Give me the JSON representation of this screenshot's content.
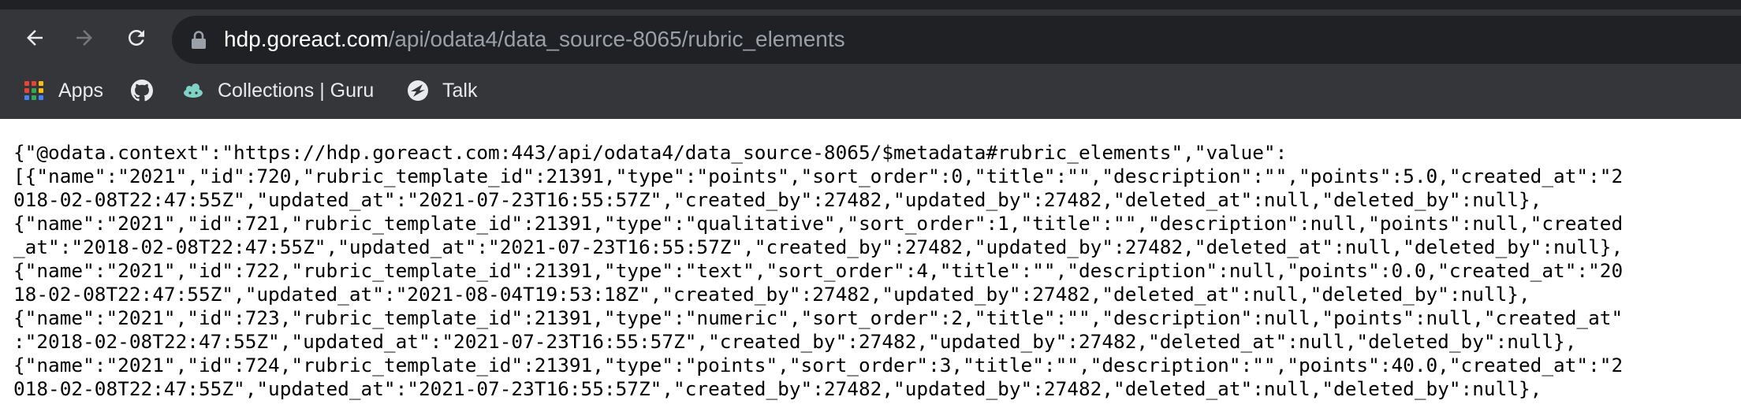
{
  "browser": {
    "url_host": "hdp.goreact.com",
    "url_path": "/api/odata4/data_source-8065/rubric_elements",
    "bookmarks": [
      {
        "label": "Apps",
        "icon": "apps-grid-icon"
      },
      {
        "label": "",
        "icon": "github-icon"
      },
      {
        "label": "Collections | Guru",
        "icon": "guru-icon"
      },
      {
        "label": "Talk",
        "icon": "talk-icon"
      }
    ]
  },
  "response": {
    "lines": [
      "{\"@odata.context\":\"https://hdp.goreact.com:443/api/odata4/data_source-8065/$metadata#rubric_elements\",\"value\":",
      "[{\"name\":\"2021\",\"id\":720,\"rubric_template_id\":21391,\"type\":\"points\",\"sort_order\":0,\"title\":\"\",\"description\":\"\",\"points\":5.0,\"created_at\":\"2",
      "018-02-08T22:47:55Z\",\"updated_at\":\"2021-07-23T16:55:57Z\",\"created_by\":27482,\"updated_by\":27482,\"deleted_at\":null,\"deleted_by\":null},",
      "{\"name\":\"2021\",\"id\":721,\"rubric_template_id\":21391,\"type\":\"qualitative\",\"sort_order\":1,\"title\":\"\",\"description\":null,\"points\":null,\"created",
      "_at\":\"2018-02-08T22:47:55Z\",\"updated_at\":\"2021-07-23T16:55:57Z\",\"created_by\":27482,\"updated_by\":27482,\"deleted_at\":null,\"deleted_by\":null},",
      "{\"name\":\"2021\",\"id\":722,\"rubric_template_id\":21391,\"type\":\"text\",\"sort_order\":4,\"title\":\"\",\"description\":null,\"points\":0.0,\"created_at\":\"20",
      "18-02-08T22:47:55Z\",\"updated_at\":\"2021-08-04T19:53:18Z\",\"created_by\":27482,\"updated_by\":27482,\"deleted_at\":null,\"deleted_by\":null},",
      "{\"name\":\"2021\",\"id\":723,\"rubric_template_id\":21391,\"type\":\"numeric\",\"sort_order\":2,\"title\":\"\",\"description\":null,\"points\":null,\"created_at\"",
      ":\"2018-02-08T22:47:55Z\",\"updated_at\":\"2021-07-23T16:55:57Z\",\"created_by\":27482,\"updated_by\":27482,\"deleted_at\":null,\"deleted_by\":null},",
      "{\"name\":\"2021\",\"id\":724,\"rubric_template_id\":21391,\"type\":\"points\",\"sort_order\":3,\"title\":\"\",\"description\":\"\",\"points\":40.0,\"created_at\":\"2",
      "018-02-08T22:47:55Z\",\"updated_at\":\"2021-07-23T16:55:57Z\",\"created_by\":27482,\"updated_by\":27482,\"deleted_at\":null,\"deleted_by\":null},"
    ]
  },
  "colors": {
    "toolbar": "#35363a",
    "omnibox": "#202124",
    "url_host": "#ffffff",
    "url_path": "#9aa0a6",
    "page_bg": "#ffffff",
    "text": "#000000"
  }
}
